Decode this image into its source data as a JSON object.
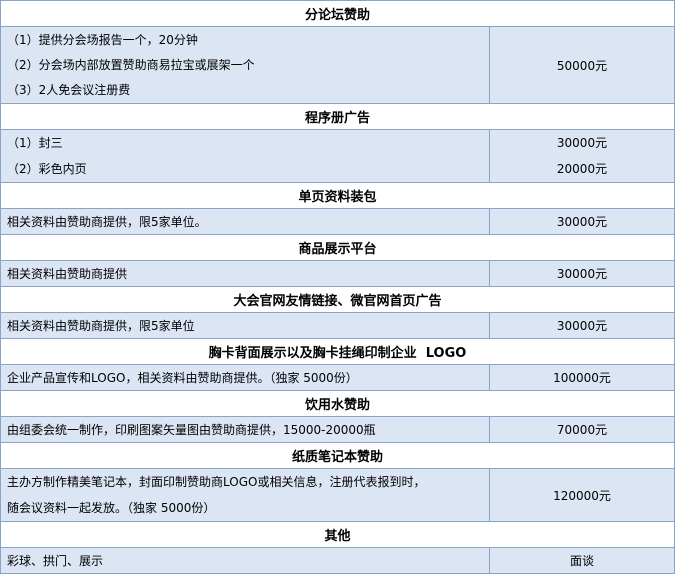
{
  "sections": [
    {
      "title": "分论坛赞助",
      "items": [
        "（1）提供分会场报告一个，20分钟",
        "（2）分会场内部放置赞助商易拉宝或展架一个",
        "（3）2人免会议注册费"
      ],
      "prices": [
        "50000元"
      ]
    },
    {
      "title": "程序册广告",
      "items": [
        "（1）封三",
        "（2）彩色内页"
      ],
      "prices": [
        "30000元",
        "20000元"
      ]
    },
    {
      "title": "单页资料装包",
      "items": [
        "相关资料由赞助商提供，限5家单位。"
      ],
      "prices": [
        "30000元"
      ]
    },
    {
      "title": "商品展示平台",
      "items": [
        "相关资料由赞助商提供"
      ],
      "prices": [
        "30000元"
      ]
    },
    {
      "title": "大会官网友情链接、微官网首页广告",
      "items": [
        "相关资料由赞助商提供，限5家单位"
      ],
      "prices": [
        "30000元"
      ]
    },
    {
      "title": "胸卡背面展示以及胸卡挂绳印制企业  LOGO",
      "items": [
        "企业产品宣传和LOGO，相关资料由赞助商提供。（独家 5000份）"
      ],
      "prices": [
        "100000元"
      ]
    },
    {
      "title": "饮用水赞助",
      "items": [
        "由组委会统一制作，印刷图案矢量图由赞助商提供，15000-20000瓶"
      ],
      "prices": [
        "70000元"
      ]
    },
    {
      "title": "纸质笔记本赞助",
      "items": [
        "主办方制作精美笔记本，封面印制赞助商LOGO或相关信息，注册代表报到时，",
        "随会议资料一起发放。（独家 5000份）"
      ],
      "prices": [
        "120000元"
      ]
    },
    {
      "title": "其他",
      "items": [
        "彩球、拱门、展示"
      ],
      "prices": [
        "面谈"
      ]
    }
  ]
}
